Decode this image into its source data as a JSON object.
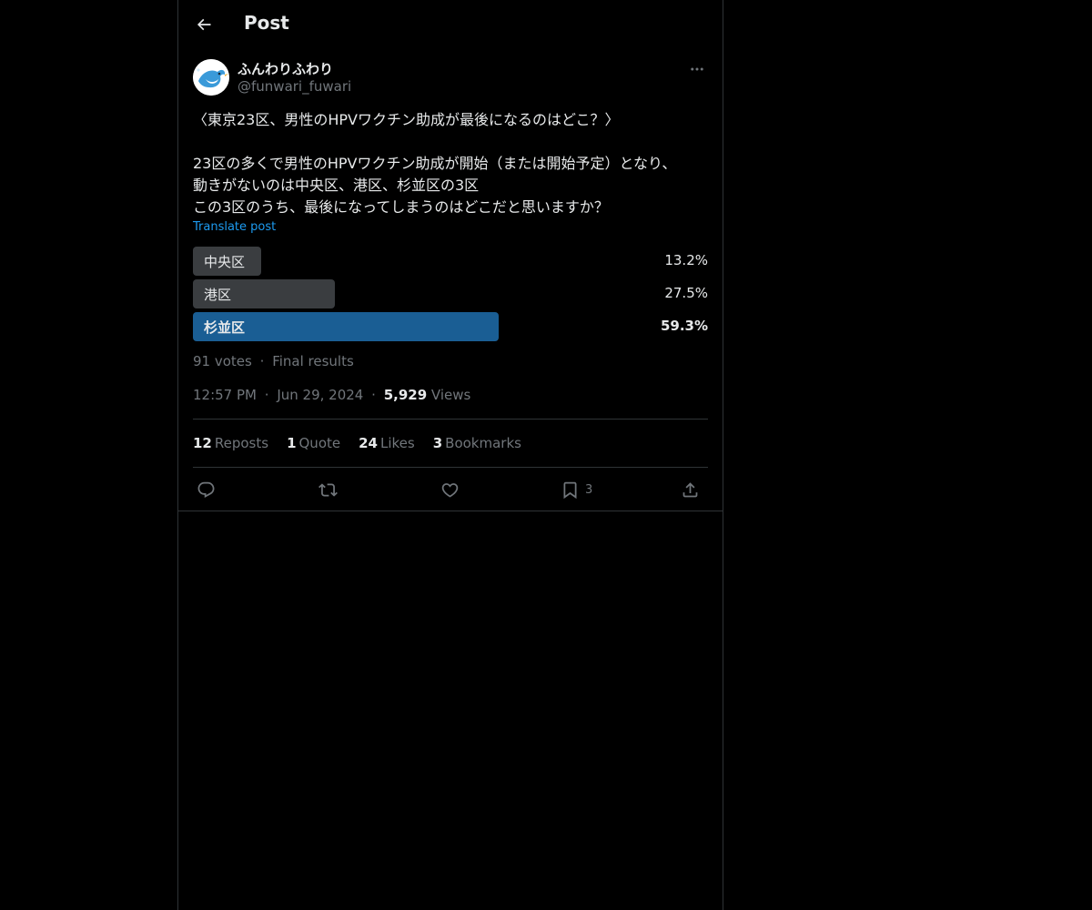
{
  "header": {
    "title": "Post",
    "back_icon": "arrow-left-icon"
  },
  "author": {
    "display_name": "ふんわりふわり",
    "handle": "@funwari_fuwari",
    "avatar_icon": "bird-avatar-icon"
  },
  "post": {
    "text": "〈東京23区、男性のHPVワクチン助成が最後になるのはどこ？〉\n\n23区の多くで男性のHPVワクチン助成が開始（または開始予定）となり、\n動きがないのは中央区、港区、杉並区の3区\nこの3区のうち、最後になってしまうのはどこだと思いますか？",
    "translate_label": "Translate post"
  },
  "poll": {
    "options": [
      {
        "label": "中央区",
        "percent_label": "13.2%",
        "percent": 13.2
      },
      {
        "label": "港区",
        "percent_label": "27.5%",
        "percent": 27.5
      },
      {
        "label": "杉並区",
        "percent_label": "59.3%",
        "percent": 59.3
      }
    ],
    "votes": "91 votes",
    "separator": "·",
    "status": "Final results"
  },
  "meta": {
    "time": "12:57 PM",
    "sep1": "·",
    "date": "Jun 29, 2024",
    "sep2": "·",
    "views_count": "5,929",
    "views_label": "Views"
  },
  "stats": [
    {
      "count": "12",
      "label": "Reposts"
    },
    {
      "count": "1",
      "label": "Quote"
    },
    {
      "count": "24",
      "label": "Likes"
    },
    {
      "count": "3",
      "label": "Bookmarks"
    }
  ],
  "actions": {
    "bookmark_count": "3"
  },
  "colors": {
    "background": "#000000",
    "text": "#e7e9ea",
    "muted": "#71767b",
    "accent": "#1d9bf0",
    "poll_winner": "#1a5e94",
    "poll_other": "#3a3d40",
    "border": "#2f3336"
  }
}
